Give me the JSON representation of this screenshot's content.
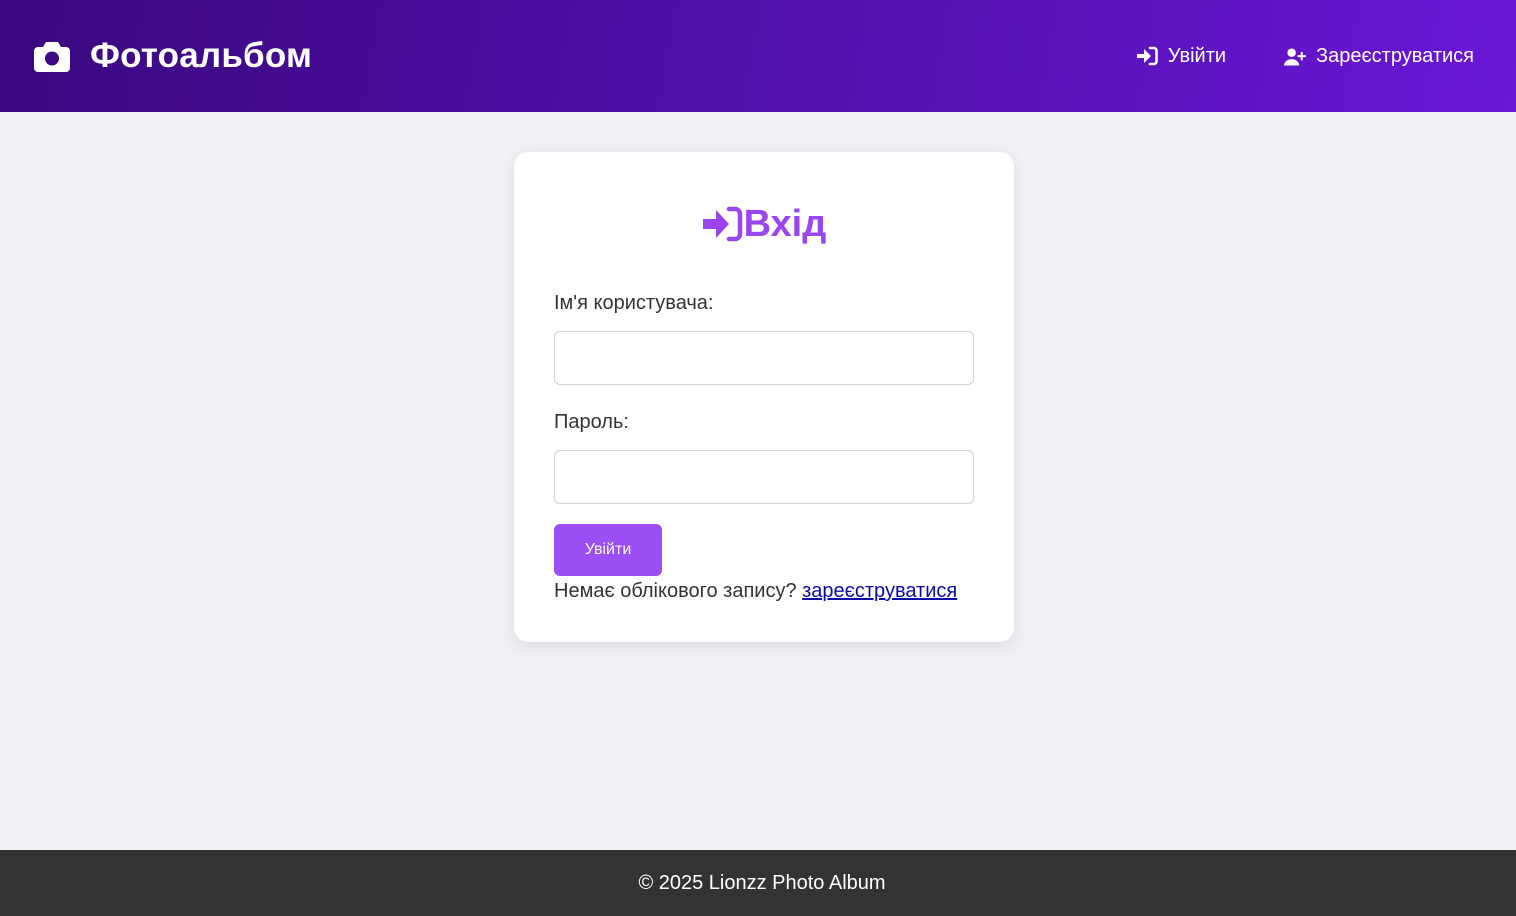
{
  "header": {
    "brand_icon": "camera-icon",
    "brand_title": "Фотоальбом",
    "nav": [
      {
        "label": "Увійти",
        "icon": "sign-in-icon"
      },
      {
        "label": "Зареєструватися",
        "icon": "user-plus-icon"
      }
    ],
    "gradient_colors": [
      "#3a087f",
      "#6a17d6"
    ]
  },
  "login_card": {
    "icon": "sign-in-icon",
    "title": "Вхід",
    "accent_color": "#9b45f0",
    "username_label": "Ім'я користувача:",
    "username_value": "",
    "password_label": "Пароль:",
    "password_value": "",
    "submit_label": "Увійти",
    "register_prompt": "Немає облікового запису?",
    "register_link": "зареєструватися",
    "link_color": "#0a0aa8"
  },
  "footer": {
    "text": "© 2025 Lionzz Photo Album",
    "background": "#333333"
  }
}
